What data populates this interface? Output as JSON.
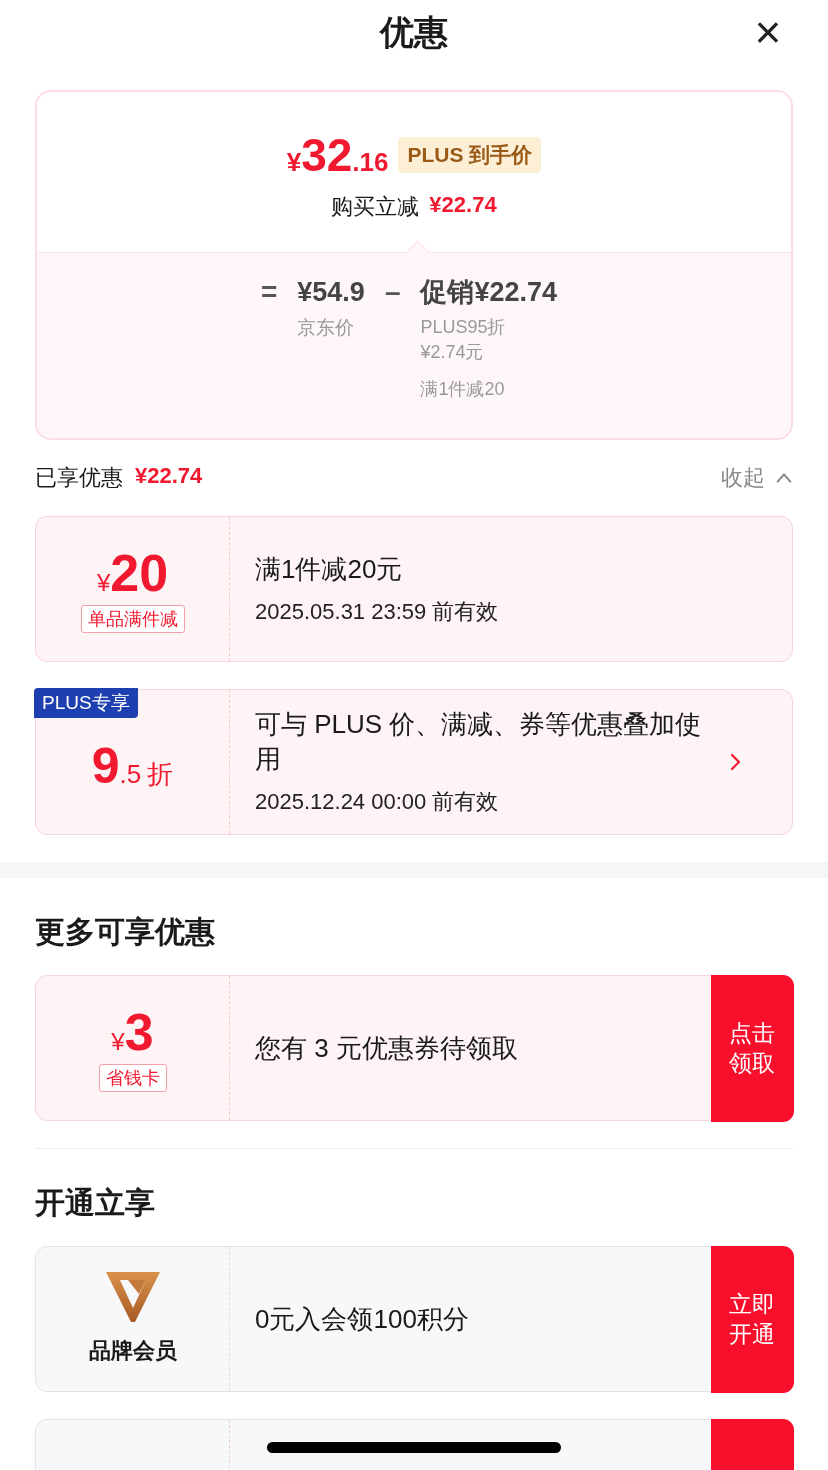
{
  "header": {
    "title": "优惠",
    "close": "×"
  },
  "summary": {
    "currency": "¥",
    "price_int": "32",
    "price_dec": ".16",
    "badge": "PLUS 到手价",
    "reduce_label": "购买立减",
    "reduce_amount": "¥22.74",
    "formula": {
      "equals": "=",
      "base_price": "¥54.9",
      "base_label": "京东价",
      "minus": "–",
      "promo": "促销¥22.74",
      "promo_details": [
        {
          "lines": [
            "PLUS95折",
            "¥2.74元"
          ]
        },
        {
          "lines": [
            "满1件减20"
          ]
        }
      ]
    }
  },
  "applied": {
    "label": "已享优惠",
    "amount": "¥22.74",
    "toggle": "收起",
    "expanded": true
  },
  "applied_coupons": [
    {
      "kind": "amount",
      "currency": "¥",
      "value": "20",
      "tag": "单品满件减",
      "title": "满1件减20元",
      "validity": "2025.05.31 23:59 前有效",
      "chevron": false
    },
    {
      "kind": "discount",
      "badge": "PLUS专享",
      "value_int": "9",
      "value_dec": ".5",
      "unit": "折",
      "title": "可与 PLUS 价、满减、券等优惠叠加使用",
      "validity": "2025.12.24 00:00 前有效",
      "chevron": true
    }
  ],
  "more_section": {
    "title": "更多可享优惠",
    "cards": [
      {
        "kind": "amount",
        "currency": "¥",
        "value": "3",
        "tag": "省钱卡",
        "title": "您有 3 元优惠券待领取",
        "button": "点击领取"
      }
    ]
  },
  "open_section": {
    "title": "开通立享",
    "cards": [
      {
        "kind": "logo",
        "label": "品牌会员",
        "title": "0元入会领100积分",
        "button": "立即开通"
      },
      {
        "kind": "partial"
      }
    ]
  }
}
